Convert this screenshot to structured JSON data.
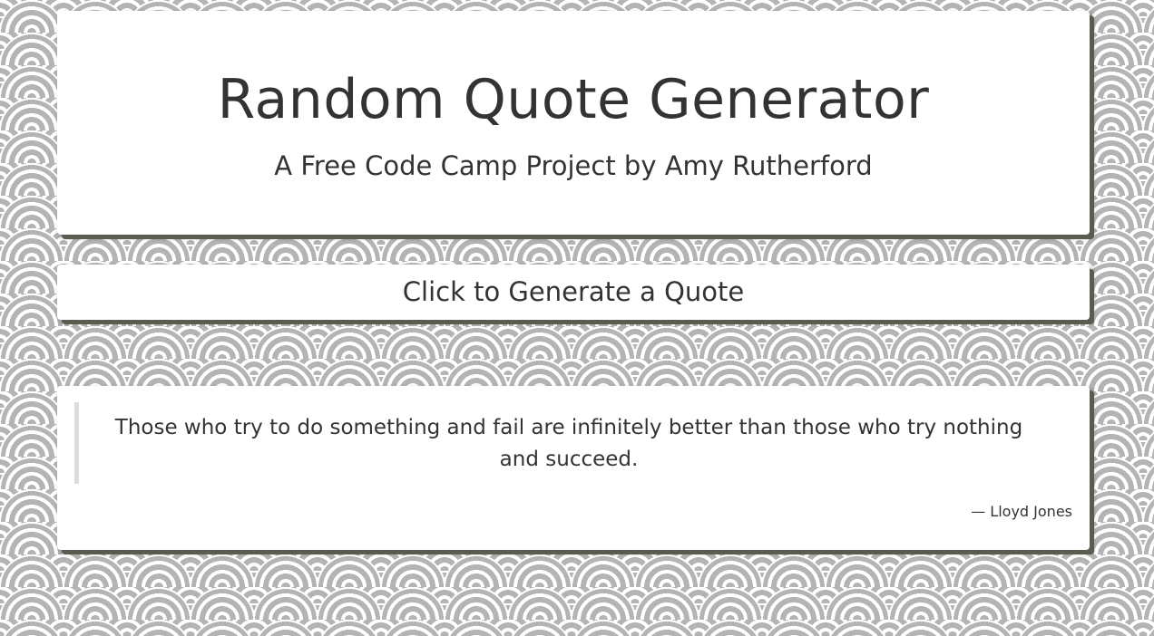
{
  "header": {
    "title": "Random Quote Generator",
    "subtitle": "A Free Code Camp Project by Amy Rutherford"
  },
  "actions": {
    "generate_label": "Click to Generate a Quote"
  },
  "quote": {
    "text": "Those who try to do something and fail are infinitely better than those who try nothing and succeed.",
    "author": "— Lloyd Jones"
  },
  "colors": {
    "text": "#333333",
    "card_background": "#ffffff",
    "card_shadow": "#5b5b50",
    "pattern_gray": "#b4b4b4",
    "pattern_white": "#ffffff",
    "quote_border": "#dddddd"
  }
}
